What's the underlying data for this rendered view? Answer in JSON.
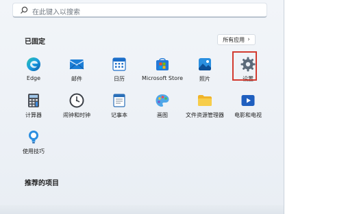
{
  "search": {
    "placeholder": "在此键入以搜索"
  },
  "pinned": {
    "title": "已固定",
    "all_apps_label": "所有应用",
    "apps": [
      {
        "label": "Edge",
        "icon": "edge-icon"
      },
      {
        "label": "邮件",
        "icon": "mail-icon"
      },
      {
        "label": "日历",
        "icon": "calendar-icon"
      },
      {
        "label": "Microsoft Store",
        "icon": "store-icon"
      },
      {
        "label": "照片",
        "icon": "photos-icon"
      },
      {
        "label": "设置",
        "icon": "gear-icon",
        "highlighted": true
      },
      {
        "label": "计算器",
        "icon": "calculator-icon"
      },
      {
        "label": "闹钟和时钟",
        "icon": "clock-icon"
      },
      {
        "label": "记事本",
        "icon": "notepad-icon"
      },
      {
        "label": "画图",
        "icon": "paint-icon"
      },
      {
        "label": "文件资源管理器",
        "icon": "folder-icon"
      },
      {
        "label": "电影和电视",
        "icon": "video-icon"
      },
      {
        "label": "使用技巧",
        "icon": "tips-icon"
      }
    ]
  },
  "recommended": {
    "title": "推荐的项目"
  },
  "colors": {
    "highlight": "#d23a2f",
    "accent": "#0078d4"
  }
}
